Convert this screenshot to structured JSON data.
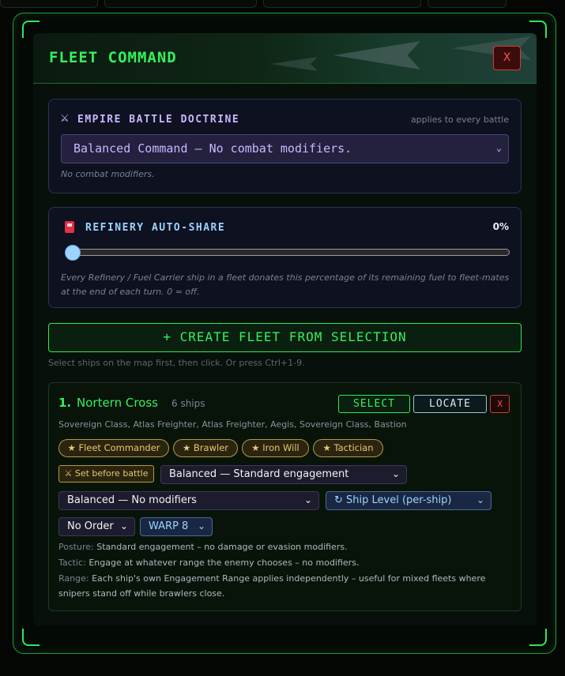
{
  "window": {
    "title": "FLEET COMMAND",
    "close_label": "X"
  },
  "doctrine": {
    "icon": "crossed-swords-icon",
    "title": "EMPIRE BATTLE DOCTRINE",
    "scope_note": "applies to every battle",
    "selected": "Balanced Command — No combat modifiers.",
    "description": "No combat modifiers."
  },
  "refinery": {
    "icon": "fuel-pump-icon",
    "title": "REFINERY AUTO-SHARE",
    "value_label": "0%",
    "value": 0,
    "description": "Every Refinery / Fuel Carrier ship in a fleet donates this percentage of its remaining fuel to fleet-mates at the end of each turn. 0 = off."
  },
  "create": {
    "label": "+ CREATE FLEET FROM SELECTION",
    "hint": "Select ships on the map first, then click. Or press Ctrl+1-9."
  },
  "fleet": {
    "number": "1.",
    "name": "Nortern Cross",
    "ship_count": "6 ships",
    "select_label": "SELECT",
    "locate_label": "LOCATE",
    "remove_label": "X",
    "ships": "Sovereign Class, Atlas Freighter, Atlas Freighter, Aegis, Sovereign Class, Bastion",
    "traits": [
      "★ Fleet Commander",
      "★ Brawler",
      "★ Iron Will",
      "★ Tactician"
    ],
    "set_before_battle": "⚔ Set before battle",
    "posture_select": "Balanced — Standard engagement",
    "modifier_select": "Balanced — No modifiers",
    "level_select": "↻ Ship Level (per-ship)",
    "order_select": "No Order",
    "warp_select": "WARP 8",
    "posture_label": "Posture:",
    "posture_text": "Standard engagement – no damage or evasion modifiers.",
    "tactic_label": "Tactic:",
    "tactic_text": "Engage at whatever range the enemy chooses – no modifiers.",
    "range_label": "Range:",
    "range_text": "Each ship's own Engagement Range applies independently – useful for mixed fleets where snipers stand off while brawlers close."
  },
  "colors": {
    "accent_green": "#35f05e",
    "doctrine_purple": "#c9b6ff",
    "refinery_blue": "#9ad4ff",
    "danger_red": "#ff5050",
    "trait_gold": "#e8c96a"
  }
}
